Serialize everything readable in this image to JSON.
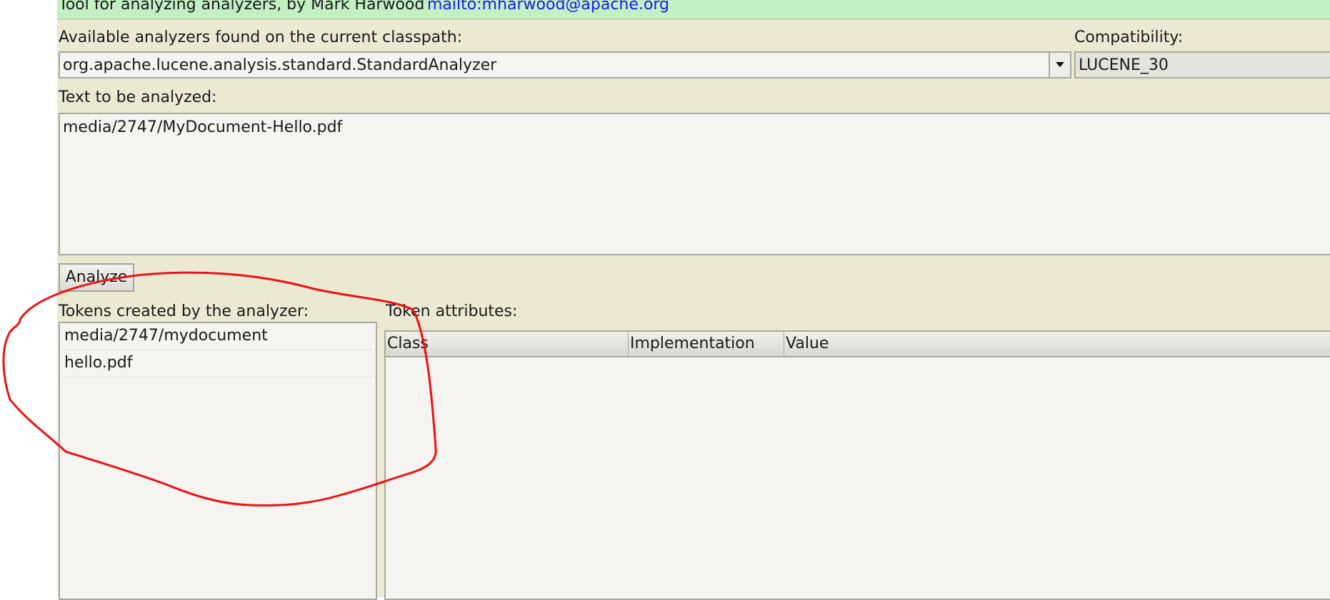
{
  "banner": {
    "description": "Tool for analyzing analyzers, by Mark Harwood",
    "email_link": "mailto:mharwood@apache.org"
  },
  "analyzer_select": {
    "label": "Available analyzers found on the current classpath:",
    "value": "org.apache.lucene.analysis.standard.StandardAnalyzer",
    "dropdown_icon": "chevron-down-icon"
  },
  "compatibility": {
    "label": "Compatibility:",
    "value": "LUCENE_30"
  },
  "text_input": {
    "label": "Text to be analyzed:",
    "value": "media/2747/MyDocument-Hello.pdf"
  },
  "analyze_button": {
    "label": "Analyze"
  },
  "tokens": {
    "label": "Tokens created by the analyzer:",
    "items": [
      "media/2747/mydocument",
      "hello.pdf"
    ]
  },
  "attributes": {
    "label": "Token attributes:",
    "columns": [
      "Class",
      "Implementation",
      "Value"
    ]
  },
  "colors": {
    "banner_bg": "#c2f0c2",
    "panel_bg": "#ece9d3",
    "link": "#1a1aee",
    "annotation": "#ee1111"
  }
}
